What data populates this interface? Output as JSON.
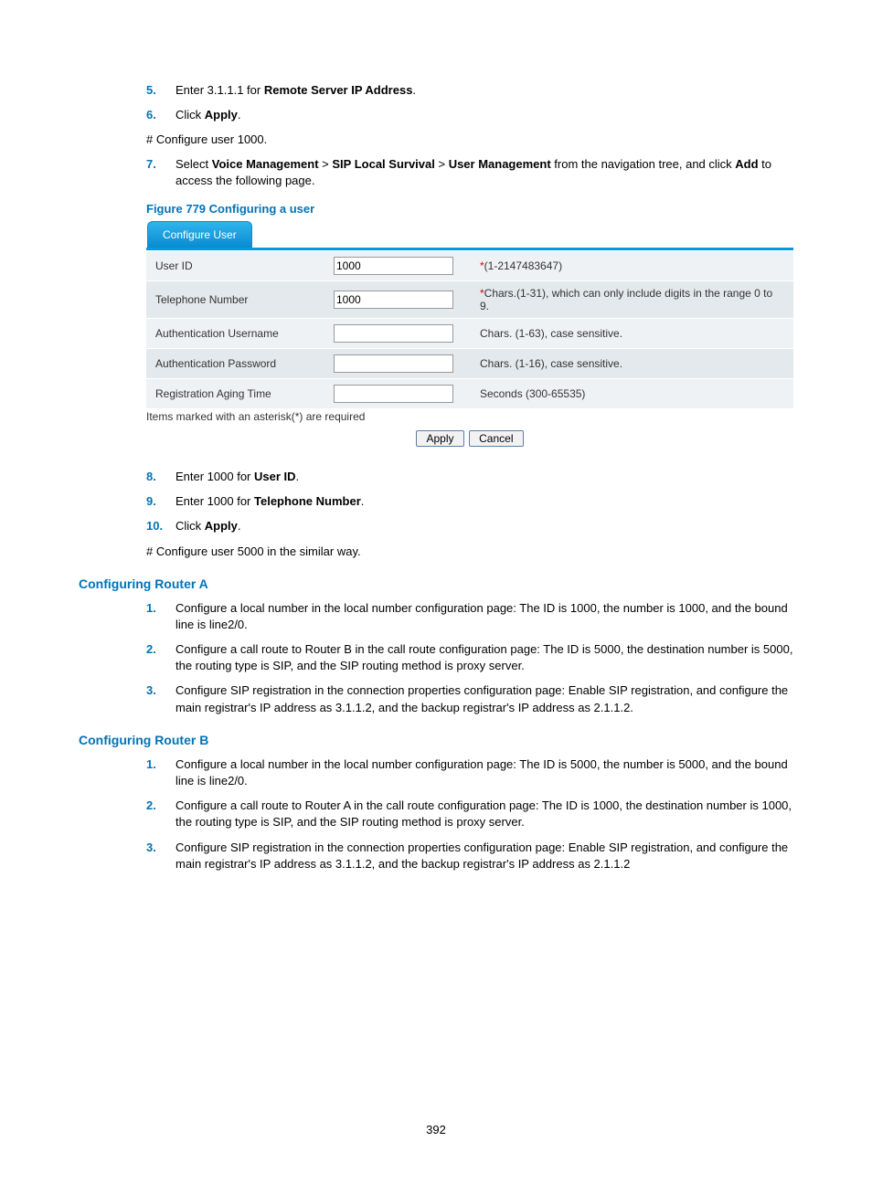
{
  "steps_top": {
    "s5": {
      "num": "5.",
      "pre": "Enter 3.1.1.1 for ",
      "bold": "Remote Server IP Address",
      "post": "."
    },
    "s6": {
      "num": "6.",
      "pre": "Click ",
      "bold": "Apply",
      "post": "."
    },
    "plain1": "# Configure user 1000.",
    "s7": {
      "num": "7.",
      "pre": "Select ",
      "b1": "Voice Management",
      "sep1": " > ",
      "b2": "SIP Local Survival",
      "sep2": " > ",
      "b3": "User Management",
      "mid": " from the navigation tree, and click ",
      "b4": "Add",
      "post": " to access the following page."
    }
  },
  "figure_caption": "Figure 779 Configuring a user",
  "panel": {
    "tab": "Configure User",
    "rows": [
      {
        "label": "User ID",
        "value": "1000",
        "hint_star": "*",
        "hint": "(1-2147483647)"
      },
      {
        "label": "Telephone Number",
        "value": "1000",
        "hint_star": "*",
        "hint": "Chars.(1-31), which can only include digits in the range 0 to 9."
      },
      {
        "label": "Authentication Username",
        "value": "",
        "hint_star": "",
        "hint": "Chars. (1-63), case sensitive."
      },
      {
        "label": "Authentication Password",
        "value": "",
        "hint_star": "",
        "hint": "Chars. (1-16), case sensitive."
      },
      {
        "label": "Registration Aging Time",
        "value": "",
        "hint_star": "",
        "hint": "Seconds (300-65535)"
      }
    ],
    "required_note": "Items marked with an asterisk(*) are required",
    "apply": "Apply",
    "cancel": "Cancel"
  },
  "steps_mid": {
    "s8": {
      "num": "8.",
      "pre": "Enter 1000 for ",
      "bold": "User ID",
      "post": "."
    },
    "s9": {
      "num": "9.",
      "pre": "Enter 1000 for ",
      "bold": "Telephone Number",
      "post": "."
    },
    "s10": {
      "num": "10.",
      "pre": "Click ",
      "bold": "Apply",
      "post": "."
    },
    "plain2": "# Configure user 5000 in the similar way."
  },
  "router_a": {
    "heading": "Configuring Router A",
    "items": [
      {
        "num": "1.",
        "text": "Configure a local number in the local number configuration page: The ID is 1000, the number is 1000, and the bound line is line2/0."
      },
      {
        "num": "2.",
        "text": "Configure a call route to Router B in the call route configuration page: The ID is 5000, the destination number is 5000, the routing type is SIP, and the SIP routing method is proxy server."
      },
      {
        "num": "3.",
        "text": "Configure SIP registration in the connection properties configuration page: Enable SIP registration, and configure the main registrar's IP address as 3.1.1.2, and the backup registrar's IP address as 2.1.1.2."
      }
    ]
  },
  "router_b": {
    "heading": "Configuring Router B",
    "items": [
      {
        "num": "1.",
        "text": "Configure a local number in the local number configuration page: The ID is 5000, the number is 5000, and the bound line is line2/0."
      },
      {
        "num": "2.",
        "text": "Configure a call route to Router A in the call route configuration page: The ID is 1000, the destination number is 1000, the routing type is SIP, and the SIP routing method is proxy server."
      },
      {
        "num": "3.",
        "text": "Configure SIP registration in the connection properties configuration page: Enable SIP registration, and configure the main registrar's IP address as 3.1.1.2, and the backup registrar's IP address as 2.1.1.2"
      }
    ]
  },
  "page_number": "392"
}
